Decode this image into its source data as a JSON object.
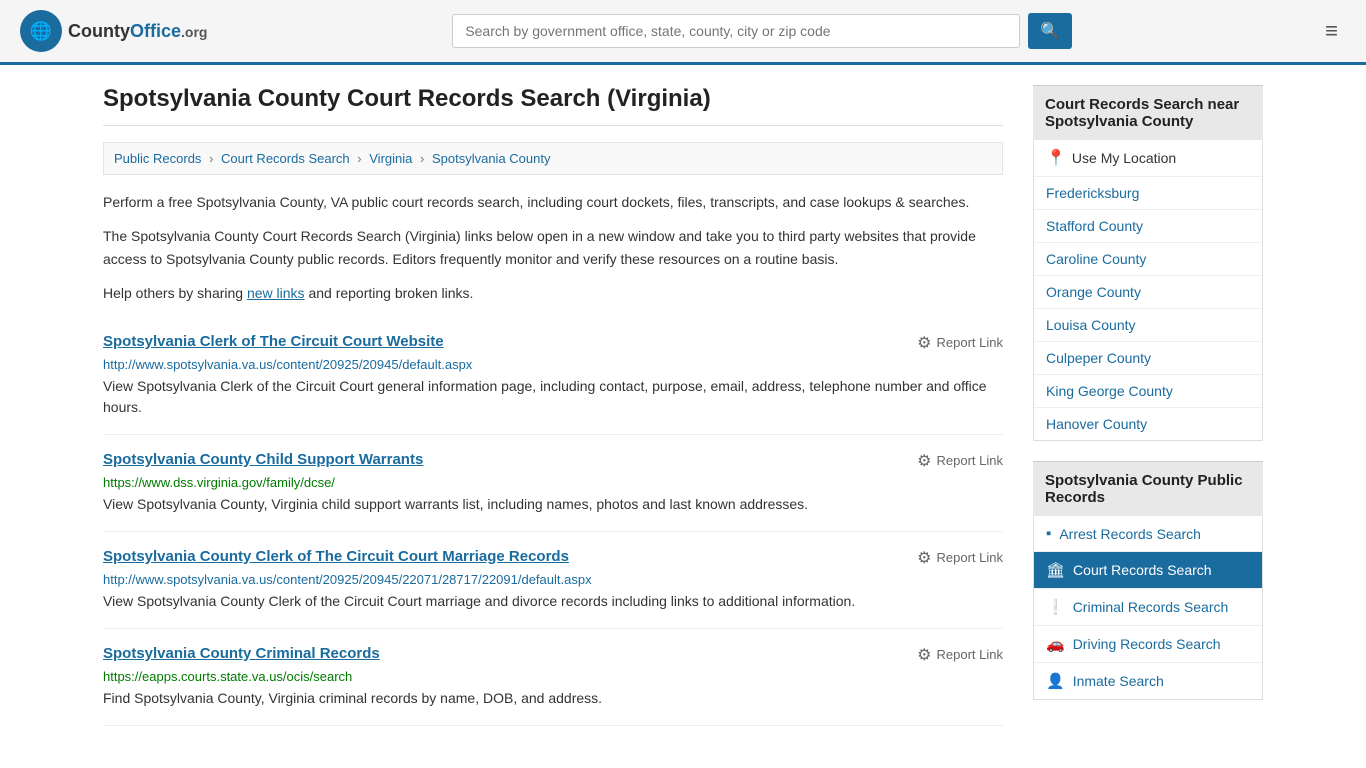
{
  "header": {
    "logo_icon": "🌐",
    "logo_name": "CountyOffice",
    "logo_org": ".org",
    "search_placeholder": "Search by government office, state, county, city or zip code",
    "search_btn_icon": "🔍",
    "menu_icon": "≡"
  },
  "page": {
    "title": "Spotsylvania County Court Records Search (Virginia)",
    "breadcrumb": [
      {
        "label": "Public Records",
        "href": "#"
      },
      {
        "label": "Court Records Search",
        "href": "#"
      },
      {
        "label": "Virginia",
        "href": "#"
      },
      {
        "label": "Spotsylvania County",
        "href": "#"
      }
    ],
    "description1": "Perform a free Spotsylvania County, VA public court records search, including court dockets, files, transcripts, and case lookups & searches.",
    "description2": "The Spotsylvania County Court Records Search (Virginia) links below open in a new window and take you to third party websites that provide access to Spotsylvania County public records. Editors frequently monitor and verify these resources on a routine basis.",
    "description3_pre": "Help others by sharing ",
    "description3_link": "new links",
    "description3_post": " and reporting broken links."
  },
  "results": [
    {
      "title": "Spotsylvania Clerk of The Circuit Court Website",
      "url": "http://www.spotsylvania.va.us/content/20925/20945/default.aspx",
      "url_color": "blue",
      "desc": "View Spotsylvania Clerk of the Circuit Court general information page, including contact, purpose, email, address, telephone number and office hours.",
      "report_label": "Report Link"
    },
    {
      "title": "Spotsylvania County Child Support Warrants",
      "url": "https://www.dss.virginia.gov/family/dcse/",
      "url_color": "green",
      "desc": "View Spotsylvania County, Virginia child support warrants list, including names, photos and last known addresses.",
      "report_label": "Report Link"
    },
    {
      "title": "Spotsylvania County Clerk of The Circuit Court Marriage Records",
      "url": "http://www.spotsylvania.va.us/content/20925/20945/22071/28717/22091/default.aspx",
      "url_color": "blue",
      "desc": "View Spotsylvania County Clerk of the Circuit Court marriage and divorce records including links to additional information.",
      "report_label": "Report Link"
    },
    {
      "title": "Spotsylvania County Criminal Records",
      "url": "https://eapps.courts.state.va.us/ocis/search",
      "url_color": "green",
      "desc": "Find Spotsylvania County, Virginia criminal records by name, DOB, and address.",
      "report_label": "Report Link"
    }
  ],
  "sidebar": {
    "nearby_title": "Court Records Search near Spotsylvania County",
    "nearby_items": [
      {
        "label": "Use My Location",
        "is_location": true
      },
      {
        "label": "Fredericksburg"
      },
      {
        "label": "Stafford County"
      },
      {
        "label": "Caroline County"
      },
      {
        "label": "Orange County"
      },
      {
        "label": "Louisa County"
      },
      {
        "label": "Culpeper County"
      },
      {
        "label": "King George County"
      },
      {
        "label": "Hanover County"
      }
    ],
    "records_title": "Spotsylvania County Public Records",
    "records_items": [
      {
        "label": "Arrest Records Search",
        "icon": "▪",
        "active": false
      },
      {
        "label": "Court Records Search",
        "icon": "🏛",
        "active": true
      },
      {
        "label": "Criminal Records Search",
        "icon": "❕",
        "active": false
      },
      {
        "label": "Driving Records Search",
        "icon": "🚗",
        "active": false
      },
      {
        "label": "Inmate Search",
        "icon": "👤",
        "active": false
      }
    ]
  }
}
